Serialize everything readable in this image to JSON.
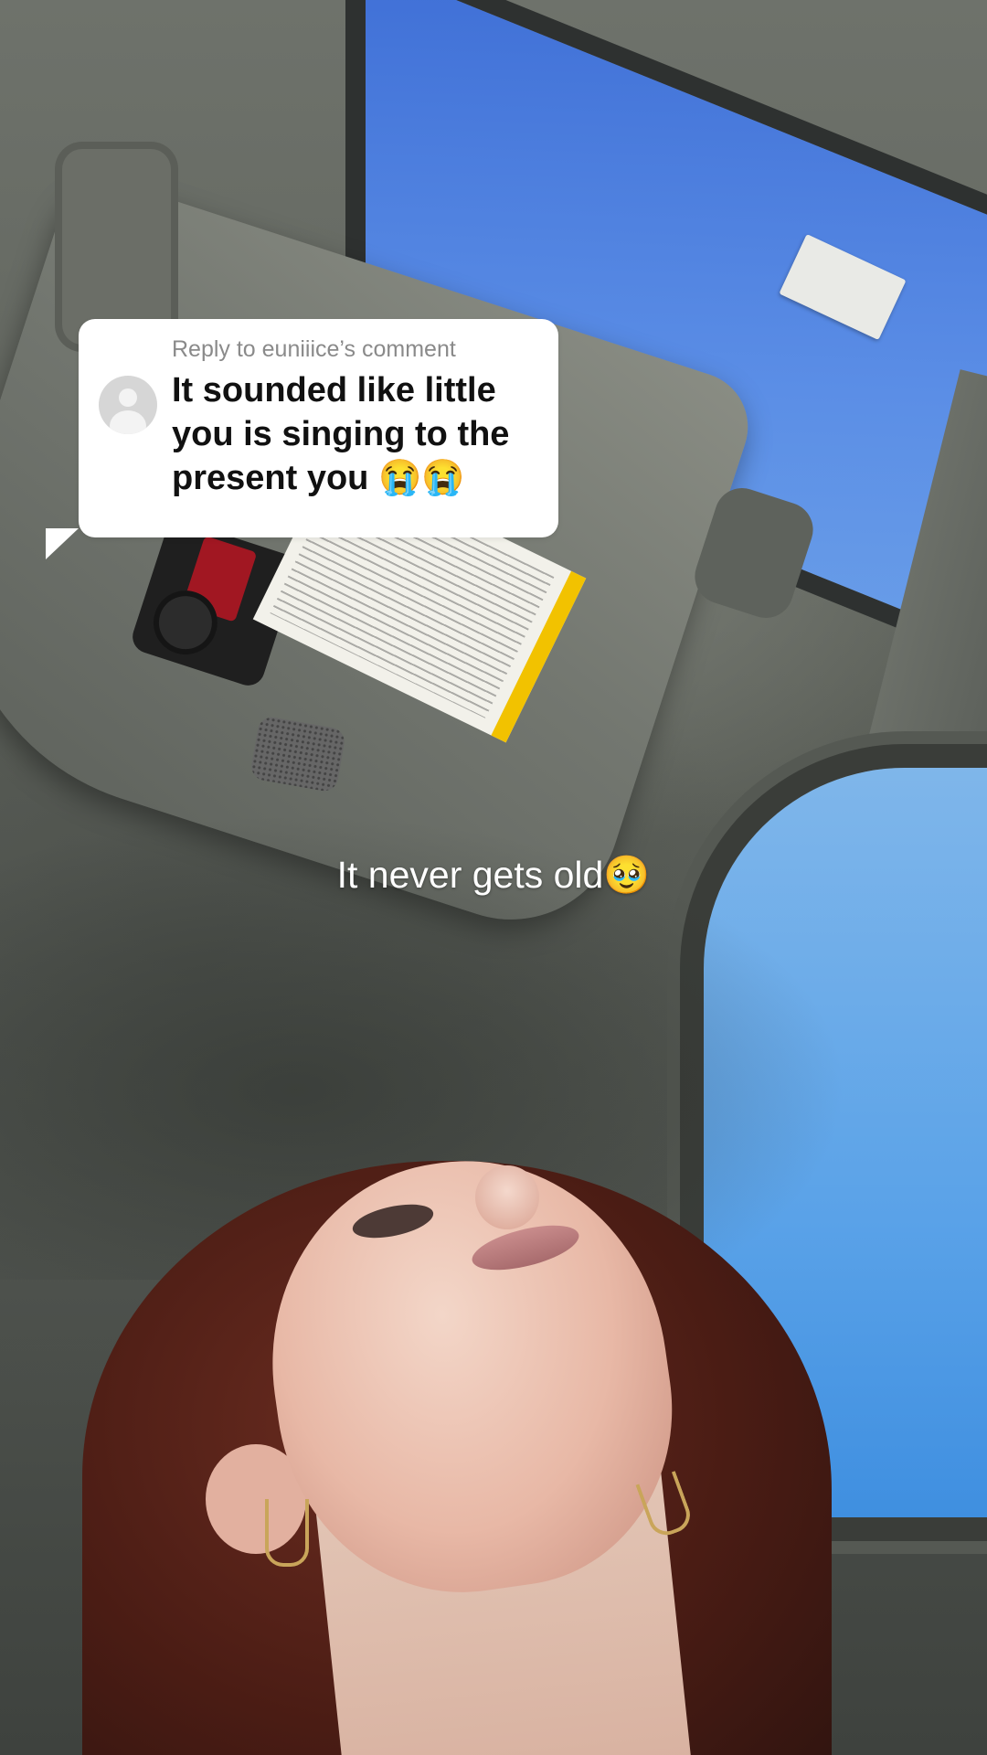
{
  "reply_card": {
    "header": "Reply to euniiice’s comment",
    "comment": "It sounded like little you is singing to the present you 😭😭"
  },
  "caption": {
    "text": "It never gets old🥹"
  }
}
